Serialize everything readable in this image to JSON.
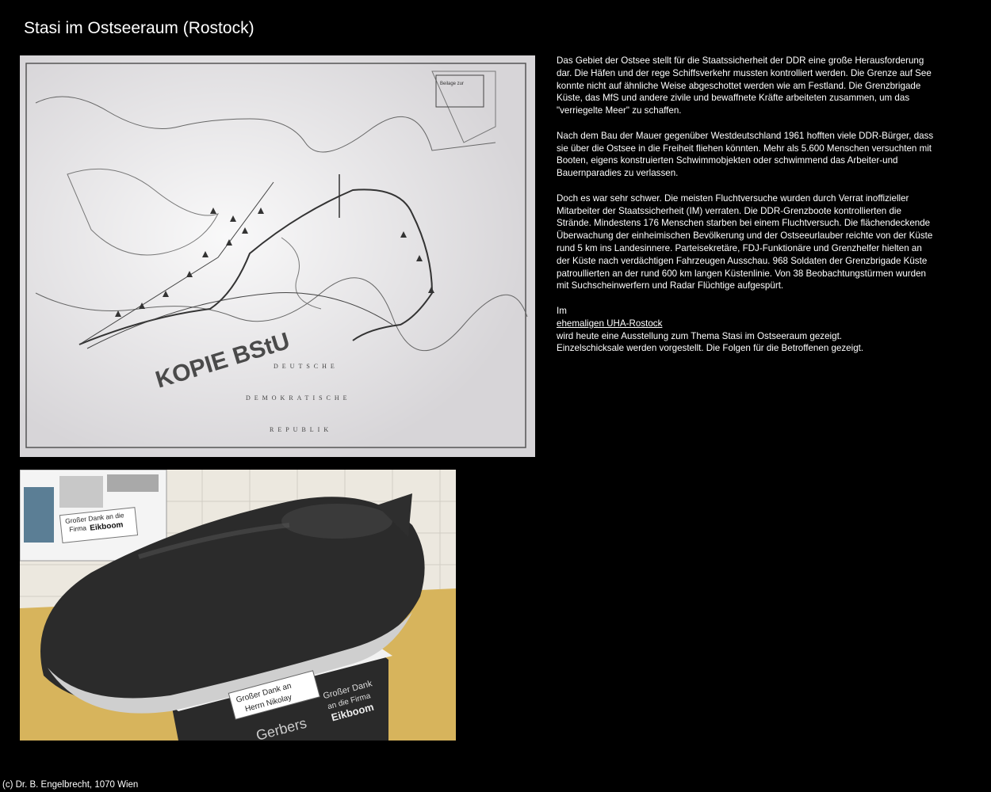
{
  "page": {
    "title": "Stasi im Ostseeraum (Rostock)",
    "footer": "(c) Dr. B. Engelbrecht, 1070 Wien"
  },
  "map_image": {
    "stamp_text": "KOPIE BStU",
    "country_words": [
      "DEUTSCHE",
      "DEMOKRATISCHE",
      "REPUBLIK"
    ],
    "corner_label": "Beilage zur"
  },
  "sub_image": {
    "poster_sign": [
      "Großer Dank an die",
      "Firma",
      "Eikboom"
    ],
    "sign_front": [
      "Großer Dank an",
      "Herrn Nikolay"
    ],
    "sign_side": [
      "Großer Dank",
      "an die Firma",
      "Eikboom"
    ],
    "sign_partial": "Gerbers"
  },
  "text": {
    "p1": "Das Gebiet der Ostsee stellt für die Staatssicherheit der DDR eine große Herausforderung dar. Die Häfen und der rege Schiffsverkehr mussten kontrolliert werden. Die Grenze auf See konnte nicht auf ähnliche Weise abgeschottet werden wie am Festland. Die Grenzbrigade Küste, das MfS und andere zivile und bewaffnete Kräfte arbeiteten zusammen, um das \"verriegelte Meer\" zu schaffen.",
    "p2": "Nach dem Bau der Mauer gegenüber Westdeutschland 1961 hofften viele DDR-Bürger, dass sie über die Ostsee in die Freiheit fliehen könnten. Mehr als 5.600 Menschen versuchten mit Booten, eigens konstruierten Schwimmobjekten oder schwimmend das Arbeiter-und Bauernparadies zu verlassen.",
    "p3": "Doch es war sehr schwer. Die meisten Fluchtversuche wurden durch Verrat inoffizieller Mitarbeiter der Staatssicherheit (IM) verraten. Die DDR-Grenzboote kontrollierten die Strände. Mindestens 176 Menschen starben bei einem Fluchtversuch. Die flächendeckende Überwachung der einheimischen Bevölkerung und der Ostseeurlauber reichte von der Küste rund 5 km ins Landesinnere. Parteisekretäre, FDJ-Funktionäre und Grenzhelfer hielten an der Küste nach verdächtigen Fahrzeugen Ausschau. 968 Soldaten der Grenzbrigade Küste patroullierten an der rund 600 km langen Küstenlinie. Von 38 Beobachtungstürmen wurden mit Suchscheinwerfern und Radar Flüchtige aufgespürt.",
    "p4_prefix": "Im",
    "p4_link": "ehemaligen UHA-Rostock",
    "p4_line1": "wird heute eine Ausstellung zum Thema Stasi im Ostseeraum gezeigt.",
    "p4_line2": "Einzelschicksale werden vorgestellt. Die Folgen für die Betroffenen gezeigt."
  }
}
